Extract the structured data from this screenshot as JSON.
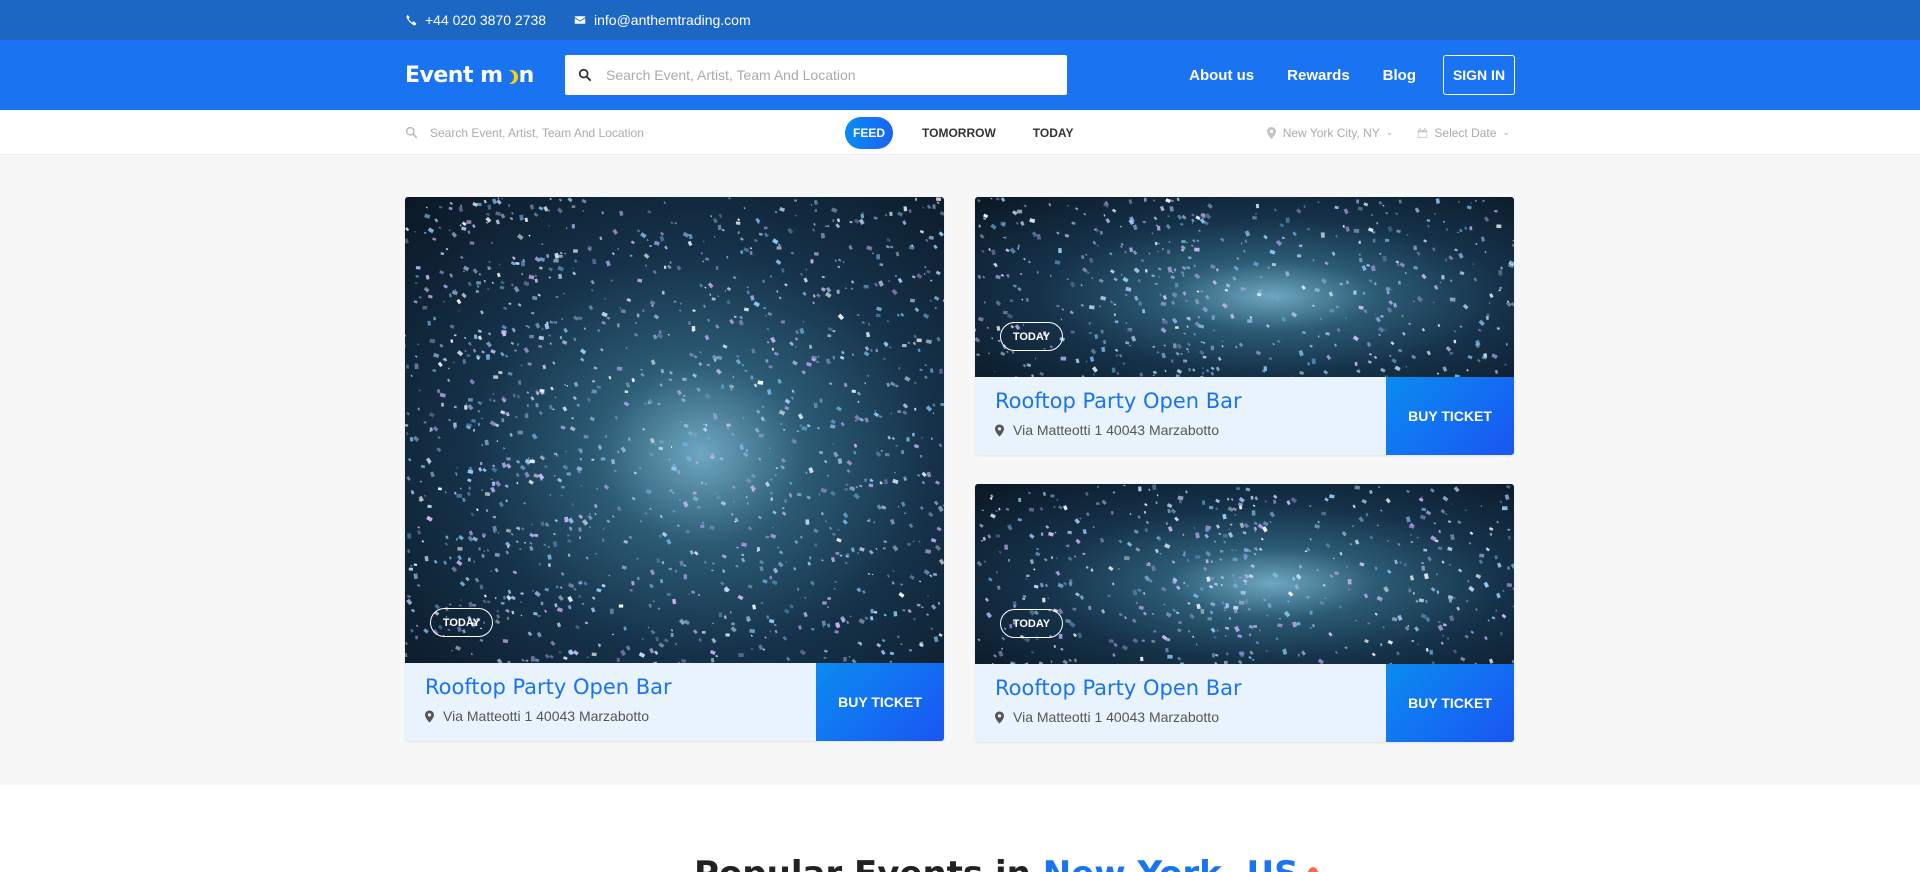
{
  "topbar": {
    "phone": "+44 020 3870 2738",
    "email": "info@anthemtrading.com"
  },
  "header": {
    "logo": {
      "part1": "Event m",
      "part2": "n"
    },
    "search_placeholder": "Search Event, Artist, Team And Location",
    "nav": [
      {
        "label": "About us"
      },
      {
        "label": "Rewards"
      },
      {
        "label": "Blog"
      }
    ],
    "signin_label": "SIGN IN"
  },
  "filterbar": {
    "search_placeholder": "Search Event, Artist, Team And Location",
    "tabs": [
      {
        "label": "FEED",
        "active": true
      },
      {
        "label": "TOMORROW"
      },
      {
        "label": "TODAY"
      }
    ],
    "location": "New York City, NY",
    "date": "Select Date"
  },
  "events": [
    {
      "badge": "TODAY",
      "title": "Rooftop Party Open Bar",
      "address": "Via Matteotti 1 40043 Marzabotto",
      "button": "BUY TICKET"
    },
    {
      "badge": "TODAY",
      "title": "Rooftop Party Open Bar",
      "address": "Via Matteotti 1 40043 Marzabotto",
      "button": "BUY TICKET"
    },
    {
      "badge": "TODAY",
      "title": "Rooftop Party Open Bar",
      "address": "Via Matteotti 1 40043 Marzabotto",
      "button": "BUY TICKET"
    }
  ],
  "popular": {
    "heading_prefix": "Popular Events in",
    "heading_highlight": "New York, US"
  },
  "colors": {
    "topbar": "#1c66c4",
    "header": "#1a74f1",
    "accent": "#1a74f1",
    "card_info_bg": "#e8f3fd"
  }
}
